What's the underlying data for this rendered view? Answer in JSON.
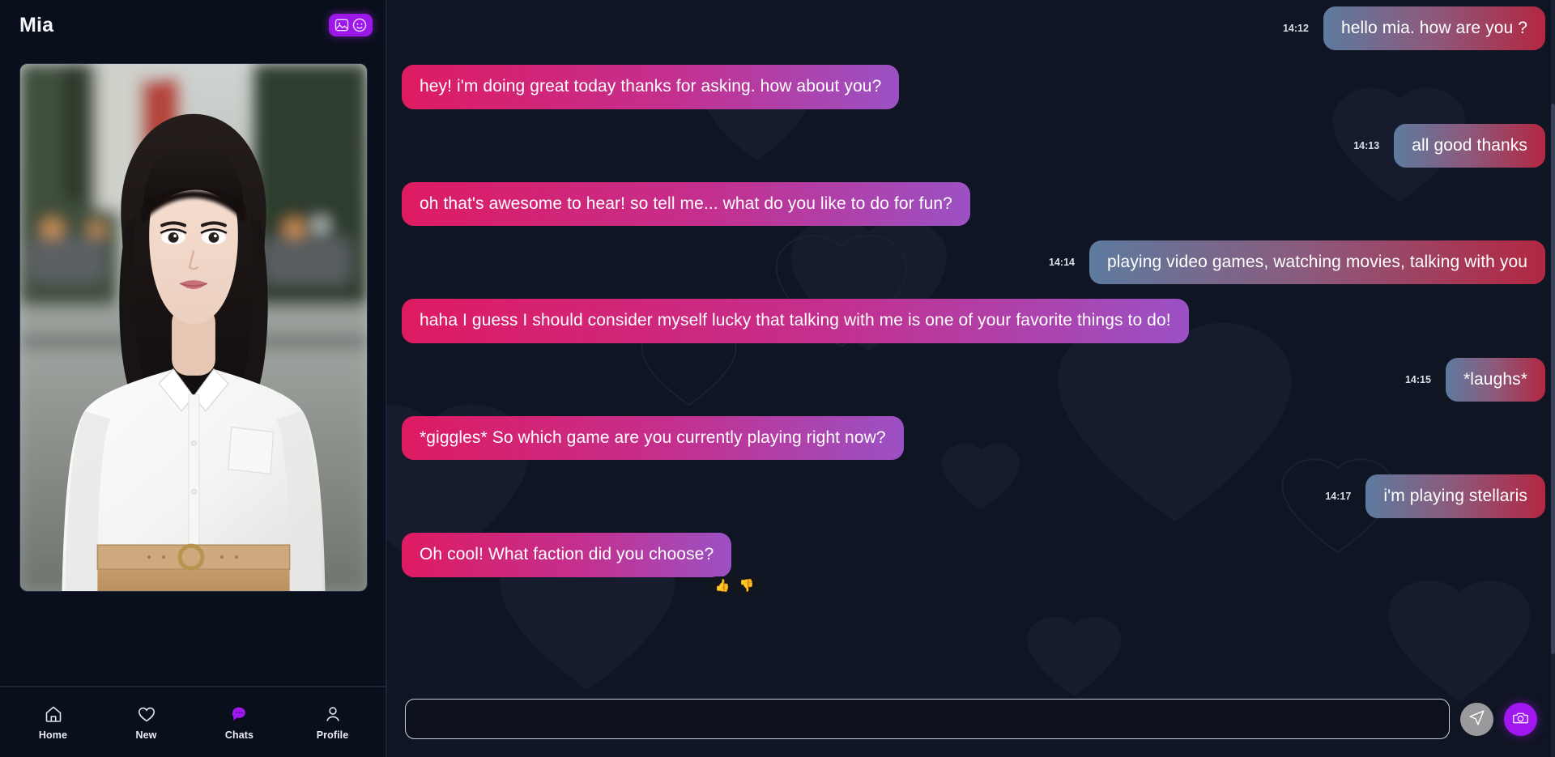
{
  "sidebar": {
    "character_name": "Mia",
    "header_badge": {
      "background_color": "#9b18e8",
      "icons": [
        "image-icon",
        "emoji-face-icon"
      ]
    },
    "avatar": {
      "name": "avatar-photo",
      "description": "Portrait of a young woman with black bangs wearing a white button-up shirt and tan belted trousers on a blurred city street"
    },
    "nav": [
      {
        "label": "Home",
        "icon": "home-icon",
        "active": false
      },
      {
        "label": "New",
        "icon": "heart-icon",
        "active": false
      },
      {
        "label": "Chats",
        "icon": "chat-bubble-icon",
        "active": true
      },
      {
        "label": "Profile",
        "icon": "person-icon",
        "active": false
      }
    ]
  },
  "chat": {
    "messages": [
      {
        "sender": "user",
        "time": "14:12",
        "text": "hello mia. how are you ?"
      },
      {
        "sender": "ai",
        "time": "",
        "text": "hey! i'm doing great today thanks for asking. how about you?"
      },
      {
        "sender": "user",
        "time": "14:13",
        "text": "all good thanks"
      },
      {
        "sender": "ai",
        "time": "",
        "text": "oh that's awesome to hear! so tell me... what do you like to do for fun?"
      },
      {
        "sender": "user",
        "time": "14:14",
        "text": "playing video games, watching movies, talking with you"
      },
      {
        "sender": "ai",
        "time": "",
        "text": "haha I guess I should consider myself lucky that talking with me is one of your favorite things to do!"
      },
      {
        "sender": "user",
        "time": "14:15",
        "text": "*laughs*"
      },
      {
        "sender": "ai",
        "time": "",
        "text": "*giggles* So which game are you currently playing right now?"
      },
      {
        "sender": "user",
        "time": "14:17",
        "text": "i'm playing stellaris"
      },
      {
        "sender": "ai",
        "time": "",
        "text": "Oh cool! What faction did you choose?"
      }
    ],
    "reactions": [
      {
        "name": "thumbs-up-reaction",
        "glyph": "👍"
      },
      {
        "name": "thumbs-down-reaction",
        "glyph": "👎"
      }
    ]
  },
  "composer": {
    "input_value": "",
    "input_placeholder": "",
    "send_icon": "send-plane-icon",
    "camera_icon": "camera-icon"
  },
  "colors": {
    "app_background": "#080c16",
    "sidebar_background": "#0a0f1c",
    "chat_background": "#101524",
    "accent_purple": "#a117f0",
    "ai_bubble_start": "#de1b62",
    "ai_bubble_end": "#9b51c4",
    "user_bubble_start": "#5d7b9f",
    "user_bubble_end": "#b32742",
    "send_button": "#9a9a9c"
  }
}
